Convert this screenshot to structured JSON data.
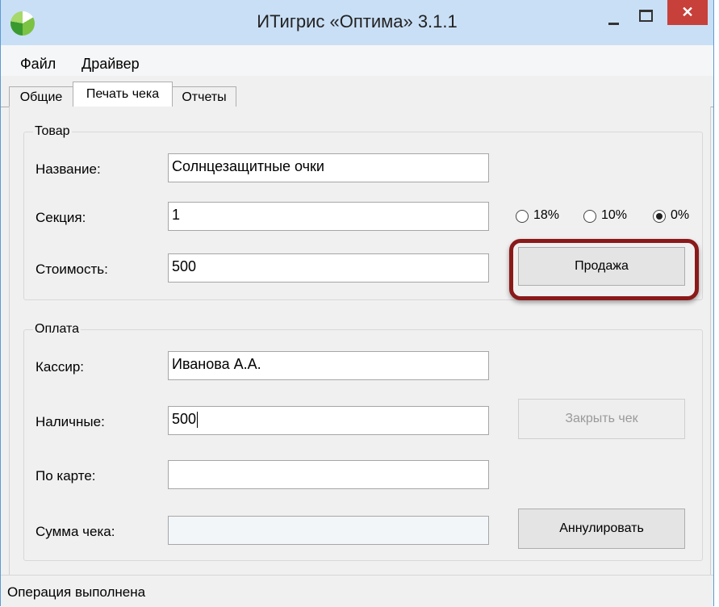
{
  "window": {
    "title": "ИТигрис «Оптима» 3.1.1",
    "close_glyph": "✕"
  },
  "menu": {
    "items": [
      {
        "label": "Файл"
      },
      {
        "label": "Драйвер"
      }
    ]
  },
  "tabs": [
    {
      "label": "Общие",
      "active": false
    },
    {
      "label": "Печать чека",
      "active": true
    },
    {
      "label": "Отчеты",
      "active": false
    }
  ],
  "product_group": {
    "title": "Товар",
    "name_label": "Название:",
    "name_value": "Солнцезащитные очки",
    "section_label": "Секция:",
    "section_value": "1",
    "price_label": "Стоимость:",
    "price_value": "500",
    "vat_options": [
      {
        "label": "18%",
        "checked": false
      },
      {
        "label": "10%",
        "checked": false
      },
      {
        "label": "0%",
        "checked": true
      }
    ],
    "sale_button": "Продажа"
  },
  "payment_group": {
    "title": "Оплата",
    "cashier_label": "Кассир:",
    "cashier_value": "Иванова А.А.",
    "cash_label": "Наличные:",
    "cash_value": "500",
    "card_label": "По карте:",
    "card_value": "",
    "total_label": "Сумма чека:",
    "total_value": "",
    "close_receipt_button": "Закрыть чек",
    "cancel_button": "Аннулировать"
  },
  "status": {
    "text": "Операция выполнена"
  },
  "colors": {
    "highlight_outline": "#8a1a1a",
    "close_button": "#c7403a",
    "titlebar": "#c9dff5"
  }
}
